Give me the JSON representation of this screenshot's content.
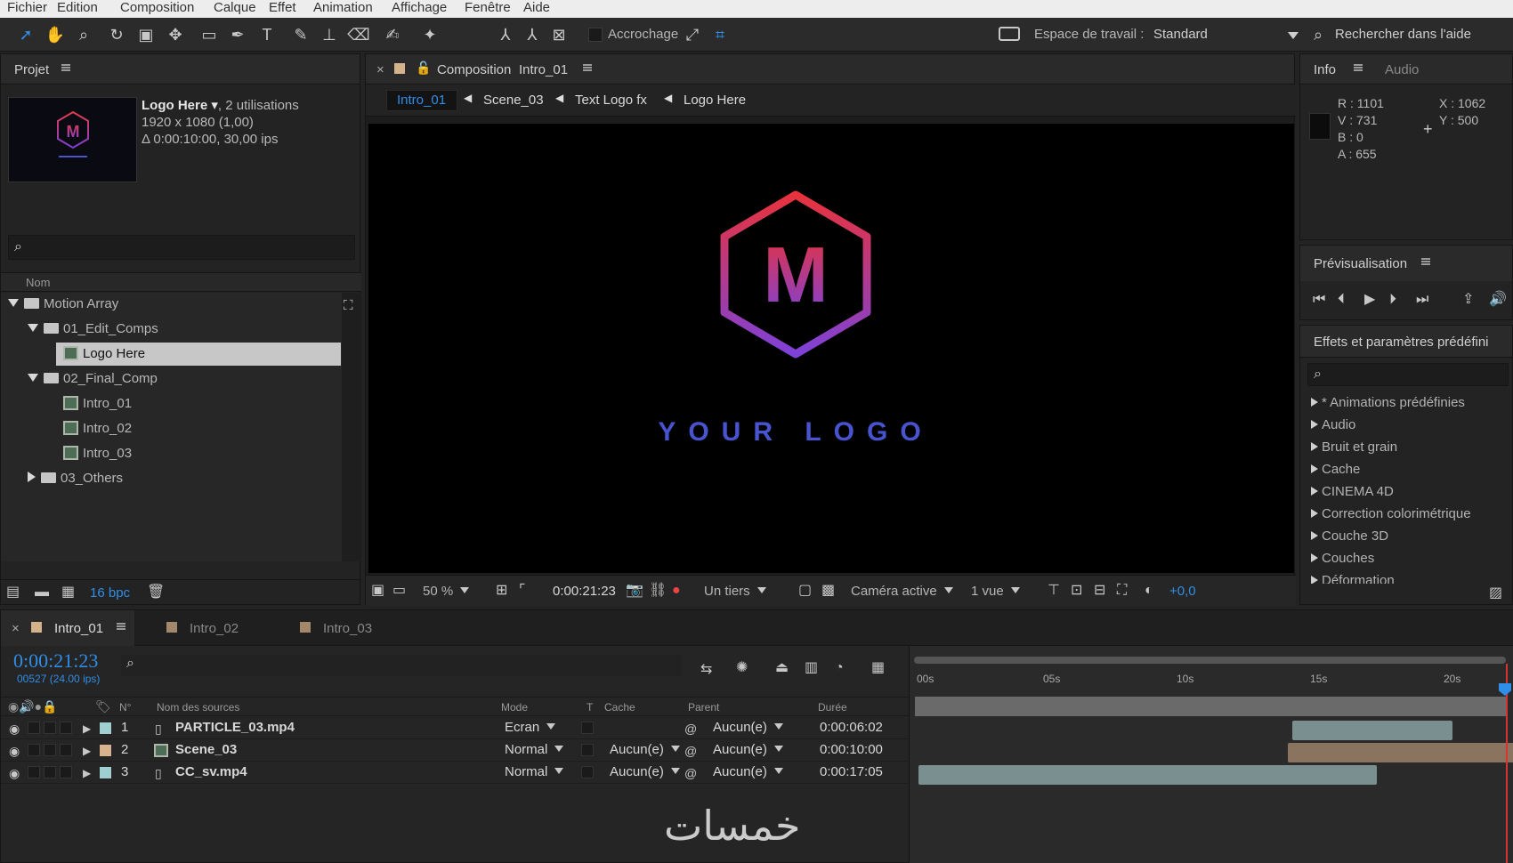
{
  "menubar": {
    "items": [
      "Fichier",
      "Edition",
      "Composition",
      "Calque",
      "Effet",
      "Animation",
      "Affichage",
      "Fenêtre",
      "Aide"
    ]
  },
  "toolbar": {
    "snap_label": "Accrochage",
    "workspace_label": "Espace de travail :",
    "workspace_value": "Standard",
    "help_search": "Rechercher dans l'aide"
  },
  "project": {
    "title": "Projet",
    "selected_name": "Logo Here",
    "selected_usage": ", 2 utilisations",
    "resolution": "1920 x 1080 (1,00)",
    "duration": "Δ 0:00:10:00, 30,00 ips",
    "column_name": "Nom",
    "tree": [
      "Motion Array",
      "01_Edit_Comps",
      "Logo Here",
      "02_Final_Comp",
      "Intro_01",
      "Intro_02",
      "Intro_03",
      "03_Others"
    ],
    "bpc": "16 bpc"
  },
  "composition": {
    "title": "Composition",
    "title_name": "Intro_01",
    "breadcrumbs": [
      "Intro_01",
      "Scene_03",
      "Text Logo fx",
      "Logo Here"
    ],
    "logo_letter": "M",
    "logo_text": "YOUR LOGO",
    "zoom": "50 %",
    "timecode": "0:00:21:23",
    "resolution": "Un tiers",
    "camera": "Caméra active",
    "views": "1 vue",
    "exposure": "+0,0"
  },
  "info": {
    "tabs": [
      "Info",
      "Audio"
    ],
    "r": "R : 1101",
    "v": "V : 731",
    "b": "B : 0",
    "a": "A : 655",
    "x": "X : 1062",
    "y": "Y : 500"
  },
  "preview": {
    "title": "Prévisualisation"
  },
  "effects": {
    "title": "Effets et paramètres prédéfini",
    "items": [
      "* Animations prédéfinies",
      "Audio",
      "Bruit et grain",
      "Cache",
      "CINEMA 4D",
      "Correction colorimétrique",
      "Couche 3D",
      "Couches",
      "Déformation"
    ]
  },
  "timeline": {
    "tabs": [
      "Intro_01",
      "Intro_02",
      "Intro_03"
    ],
    "timecode": "0:00:21:23",
    "frames": "00527 (24.00 ips)",
    "columns": {
      "num": "N°",
      "source": "Nom des sources",
      "mode": "Mode",
      "t": "T",
      "cache": "Cache",
      "parent": "Parent",
      "duration": "Durée"
    },
    "ruler": [
      "00s",
      "05s",
      "10s",
      "15s",
      "20s"
    ],
    "layers": [
      {
        "num": "1",
        "name": "PARTICLE_03.mp4",
        "mode": "Ecran",
        "cache": "",
        "parent": "Aucun(e)",
        "duration": "0:00:06:02",
        "color": "#9fcfd0"
      },
      {
        "num": "2",
        "name": "Scene_03",
        "mode": "Normal",
        "cache": "Aucun(e)",
        "parent": "Aucun(e)",
        "duration": "0:00:10:00",
        "color": "#d7b48f"
      },
      {
        "num": "3",
        "name": "CC_sv.mp4",
        "mode": "Normal",
        "cache": "Aucun(e)",
        "parent": "Aucun(e)",
        "duration": "0:00:17:05",
        "color": "#9fcfd0"
      }
    ]
  },
  "watermark": "خمسات"
}
